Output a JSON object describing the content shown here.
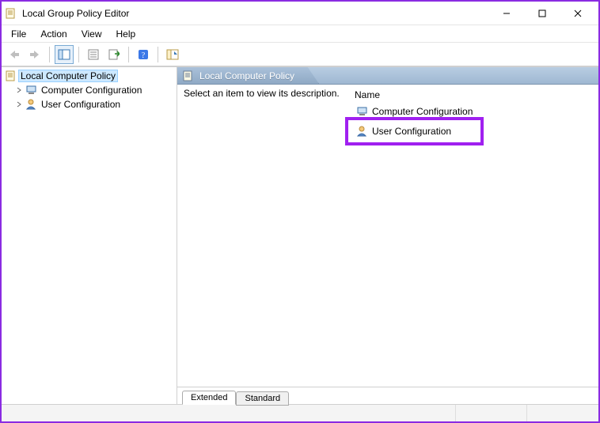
{
  "window": {
    "title": "Local Group Policy Editor"
  },
  "menu": {
    "items": [
      "File",
      "Action",
      "View",
      "Help"
    ]
  },
  "tree": {
    "root": {
      "label": "Local Computer Policy",
      "selected": true
    },
    "children": [
      {
        "label": "Computer Configuration"
      },
      {
        "label": "User Configuration"
      }
    ]
  },
  "detail": {
    "header": "Local Computer Policy",
    "description_prompt": "Select an item to view its description.",
    "columns": {
      "name": "Name"
    },
    "items": [
      {
        "label": "Computer Configuration"
      },
      {
        "label": "User Configuration"
      }
    ],
    "tabs": {
      "extended": "Extended",
      "standard": "Standard"
    }
  }
}
